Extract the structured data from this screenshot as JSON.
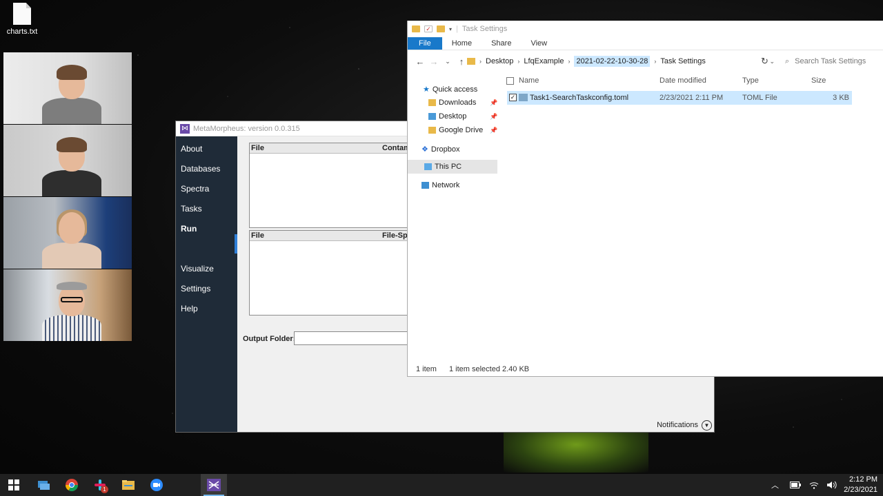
{
  "desktop": {
    "icon_label": "charts.txt"
  },
  "metamorpheus": {
    "title": "MetaMorpheus: version 0.0.315",
    "nav": [
      "About",
      "Databases",
      "Spectra",
      "Tasks",
      "Run",
      "Visualize",
      "Settings",
      "Help"
    ],
    "active_nav": "Run",
    "grid1": {
      "col1": "File",
      "col2": "Contam"
    },
    "grid2": {
      "col1": "File",
      "col2": "File-Spe"
    },
    "output_folder_label": "Output Folder:",
    "output_folder_value": "",
    "notifications_label": "Notifications"
  },
  "explorer": {
    "title": "Task Settings",
    "ribbon_tabs": [
      "File",
      "Home",
      "Share",
      "View"
    ],
    "breadcrumb": [
      "Desktop",
      "LfqExample",
      "2021-02-22-10-30-28",
      "Task Settings"
    ],
    "search_placeholder": "Search Task Settings",
    "nav_pane": {
      "quick_access": "Quick access",
      "downloads": "Downloads",
      "desktop": "Desktop",
      "google_drive": "Google Drive",
      "dropbox": "Dropbox",
      "this_pc": "This PC",
      "network": "Network"
    },
    "columns": {
      "name": "Name",
      "date": "Date modified",
      "type": "Type",
      "size": "Size"
    },
    "files": [
      {
        "name": "Task1-SearchTaskconfig.toml",
        "date": "2/23/2021 2:11 PM",
        "type": "TOML File",
        "size": "3 KB"
      }
    ],
    "status": {
      "count": "1 item",
      "selected": "1 item selected  2.40 KB"
    }
  },
  "taskbar": {
    "time": "2:12 PM",
    "date": "2/23/2021",
    "badge": "1"
  },
  "colors": {
    "accent": "#1979ca",
    "nav_bg": "#1f2b38",
    "selection": "#cce8ff"
  }
}
